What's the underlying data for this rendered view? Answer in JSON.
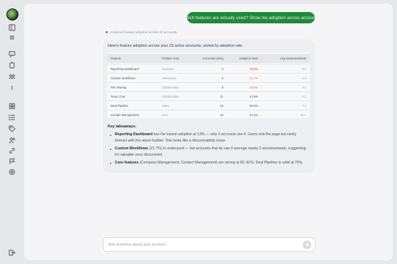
{
  "chat": {
    "user_message": "Which features are actually used? Show me adoption across accounts.",
    "status": "Analyzed feature adoption across 23 accounts",
    "answer_intro": "Here's feature adoption across your 23 active accounts, sorted by adoption rate:",
    "table": {
      "headers": [
        "Feature",
        "Product Area",
        "Accounts Using",
        "Adoption Rate",
        "Avg Sessions/Week"
      ],
      "rows": [
        {
          "feature": "Reporting Dashboard",
          "area": "Analytics",
          "accounts": "3",
          "rate": "13.0%",
          "sessions": "0.4"
        },
        {
          "feature": "Custom Workflows",
          "area": "Automation",
          "accounts": "5",
          "rate": "21.7%",
          "sessions": "1.9"
        },
        {
          "feature": "File Sharing",
          "area": "Collaboration",
          "accounts": "8",
          "rate": "34.8%",
          "sessions": "3.1"
        },
        {
          "feature": "Team Chat",
          "area": "Collaboration",
          "accounts": "11",
          "rate": "47.8%",
          "sessions": "5.1"
        },
        {
          "feature": "Deal Pipeline",
          "area": "Sales",
          "accounts": "16",
          "rate": "69.6%",
          "sessions": "7.2"
        },
        {
          "feature": "Contact Management",
          "area": "Core",
          "accounts": "19",
          "rate": "82.6%",
          "sessions": "10.1"
        }
      ]
    },
    "takeaways_title": "Key takeaways:",
    "takeaways": [
      {
        "bold": "Reporting Dashboard",
        "text": " has the lowest adoption at 13% — only 3 accounts use it. Users visit the page but rarely interact with the report builder. This looks like a discoverability issue."
      },
      {
        "bold": "Custom Workflows",
        "text": " (21.7%) is underused — but accounts that do use it average nearly 2 sessions/week, suggesting it's valuable once discovered."
      },
      {
        "bold": "Core features",
        "text": " (Company Management, Contact Management) are strong at 82–91%. Deal Pipeline is solid at 70%."
      }
    ]
  },
  "composer": {
    "placeholder": "Ask anything about your product..."
  },
  "colors": {
    "user_bubble": "#1f8a3a",
    "rate_low": "#d23c3c",
    "rate_mid": "#e08a1e",
    "rate_high": "#2e9b4d"
  },
  "icons": {
    "rail": [
      "panel-icon",
      "grid-icon",
      "chat-icon",
      "clipboard-icon",
      "team-icon",
      "info-icon",
      "dashboard-icon",
      "list-icon",
      "tag-icon",
      "people-icon",
      "link-icon",
      "flag-icon",
      "settings-icon",
      "logout-icon"
    ]
  }
}
